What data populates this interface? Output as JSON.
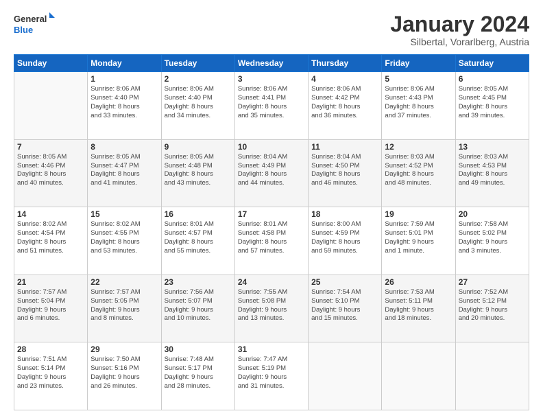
{
  "header": {
    "logo_line1": "General",
    "logo_line2": "Blue",
    "title": "January 2024",
    "subtitle": "Silbertal, Vorarlberg, Austria"
  },
  "weekdays": [
    "Sunday",
    "Monday",
    "Tuesday",
    "Wednesday",
    "Thursday",
    "Friday",
    "Saturday"
  ],
  "weeks": [
    [
      {
        "day": "",
        "sunrise": "",
        "sunset": "",
        "daylight": ""
      },
      {
        "day": "1",
        "sunrise": "Sunrise: 8:06 AM",
        "sunset": "Sunset: 4:40 PM",
        "daylight": "Daylight: 8 hours and 33 minutes."
      },
      {
        "day": "2",
        "sunrise": "Sunrise: 8:06 AM",
        "sunset": "Sunset: 4:40 PM",
        "daylight": "Daylight: 8 hours and 34 minutes."
      },
      {
        "day": "3",
        "sunrise": "Sunrise: 8:06 AM",
        "sunset": "Sunset: 4:41 PM",
        "daylight": "Daylight: 8 hours and 35 minutes."
      },
      {
        "day": "4",
        "sunrise": "Sunrise: 8:06 AM",
        "sunset": "Sunset: 4:42 PM",
        "daylight": "Daylight: 8 hours and 36 minutes."
      },
      {
        "day": "5",
        "sunrise": "Sunrise: 8:06 AM",
        "sunset": "Sunset: 4:43 PM",
        "daylight": "Daylight: 8 hours and 37 minutes."
      },
      {
        "day": "6",
        "sunrise": "Sunrise: 8:05 AM",
        "sunset": "Sunset: 4:45 PM",
        "daylight": "Daylight: 8 hours and 39 minutes."
      }
    ],
    [
      {
        "day": "7",
        "sunrise": "Sunrise: 8:05 AM",
        "sunset": "Sunset: 4:46 PM",
        "daylight": "Daylight: 8 hours and 40 minutes."
      },
      {
        "day": "8",
        "sunrise": "Sunrise: 8:05 AM",
        "sunset": "Sunset: 4:47 PM",
        "daylight": "Daylight: 8 hours and 41 minutes."
      },
      {
        "day": "9",
        "sunrise": "Sunrise: 8:05 AM",
        "sunset": "Sunset: 4:48 PM",
        "daylight": "Daylight: 8 hours and 43 minutes."
      },
      {
        "day": "10",
        "sunrise": "Sunrise: 8:04 AM",
        "sunset": "Sunset: 4:49 PM",
        "daylight": "Daylight: 8 hours and 44 minutes."
      },
      {
        "day": "11",
        "sunrise": "Sunrise: 8:04 AM",
        "sunset": "Sunset: 4:50 PM",
        "daylight": "Daylight: 8 hours and 46 minutes."
      },
      {
        "day": "12",
        "sunrise": "Sunrise: 8:03 AM",
        "sunset": "Sunset: 4:52 PM",
        "daylight": "Daylight: 8 hours and 48 minutes."
      },
      {
        "day": "13",
        "sunrise": "Sunrise: 8:03 AM",
        "sunset": "Sunset: 4:53 PM",
        "daylight": "Daylight: 8 hours and 49 minutes."
      }
    ],
    [
      {
        "day": "14",
        "sunrise": "Sunrise: 8:02 AM",
        "sunset": "Sunset: 4:54 PM",
        "daylight": "Daylight: 8 hours and 51 minutes."
      },
      {
        "day": "15",
        "sunrise": "Sunrise: 8:02 AM",
        "sunset": "Sunset: 4:55 PM",
        "daylight": "Daylight: 8 hours and 53 minutes."
      },
      {
        "day": "16",
        "sunrise": "Sunrise: 8:01 AM",
        "sunset": "Sunset: 4:57 PM",
        "daylight": "Daylight: 8 hours and 55 minutes."
      },
      {
        "day": "17",
        "sunrise": "Sunrise: 8:01 AM",
        "sunset": "Sunset: 4:58 PM",
        "daylight": "Daylight: 8 hours and 57 minutes."
      },
      {
        "day": "18",
        "sunrise": "Sunrise: 8:00 AM",
        "sunset": "Sunset: 4:59 PM",
        "daylight": "Daylight: 8 hours and 59 minutes."
      },
      {
        "day": "19",
        "sunrise": "Sunrise: 7:59 AM",
        "sunset": "Sunset: 5:01 PM",
        "daylight": "Daylight: 9 hours and 1 minute."
      },
      {
        "day": "20",
        "sunrise": "Sunrise: 7:58 AM",
        "sunset": "Sunset: 5:02 PM",
        "daylight": "Daylight: 9 hours and 3 minutes."
      }
    ],
    [
      {
        "day": "21",
        "sunrise": "Sunrise: 7:57 AM",
        "sunset": "Sunset: 5:04 PM",
        "daylight": "Daylight: 9 hours and 6 minutes."
      },
      {
        "day": "22",
        "sunrise": "Sunrise: 7:57 AM",
        "sunset": "Sunset: 5:05 PM",
        "daylight": "Daylight: 9 hours and 8 minutes."
      },
      {
        "day": "23",
        "sunrise": "Sunrise: 7:56 AM",
        "sunset": "Sunset: 5:07 PM",
        "daylight": "Daylight: 9 hours and 10 minutes."
      },
      {
        "day": "24",
        "sunrise": "Sunrise: 7:55 AM",
        "sunset": "Sunset: 5:08 PM",
        "daylight": "Daylight: 9 hours and 13 minutes."
      },
      {
        "day": "25",
        "sunrise": "Sunrise: 7:54 AM",
        "sunset": "Sunset: 5:10 PM",
        "daylight": "Daylight: 9 hours and 15 minutes."
      },
      {
        "day": "26",
        "sunrise": "Sunrise: 7:53 AM",
        "sunset": "Sunset: 5:11 PM",
        "daylight": "Daylight: 9 hours and 18 minutes."
      },
      {
        "day": "27",
        "sunrise": "Sunrise: 7:52 AM",
        "sunset": "Sunset: 5:12 PM",
        "daylight": "Daylight: 9 hours and 20 minutes."
      }
    ],
    [
      {
        "day": "28",
        "sunrise": "Sunrise: 7:51 AM",
        "sunset": "Sunset: 5:14 PM",
        "daylight": "Daylight: 9 hours and 23 minutes."
      },
      {
        "day": "29",
        "sunrise": "Sunrise: 7:50 AM",
        "sunset": "Sunset: 5:16 PM",
        "daylight": "Daylight: 9 hours and 26 minutes."
      },
      {
        "day": "30",
        "sunrise": "Sunrise: 7:48 AM",
        "sunset": "Sunset: 5:17 PM",
        "daylight": "Daylight: 9 hours and 28 minutes."
      },
      {
        "day": "31",
        "sunrise": "Sunrise: 7:47 AM",
        "sunset": "Sunset: 5:19 PM",
        "daylight": "Daylight: 9 hours and 31 minutes."
      },
      {
        "day": "",
        "sunrise": "",
        "sunset": "",
        "daylight": ""
      },
      {
        "day": "",
        "sunrise": "",
        "sunset": "",
        "daylight": ""
      },
      {
        "day": "",
        "sunrise": "",
        "sunset": "",
        "daylight": ""
      }
    ]
  ]
}
